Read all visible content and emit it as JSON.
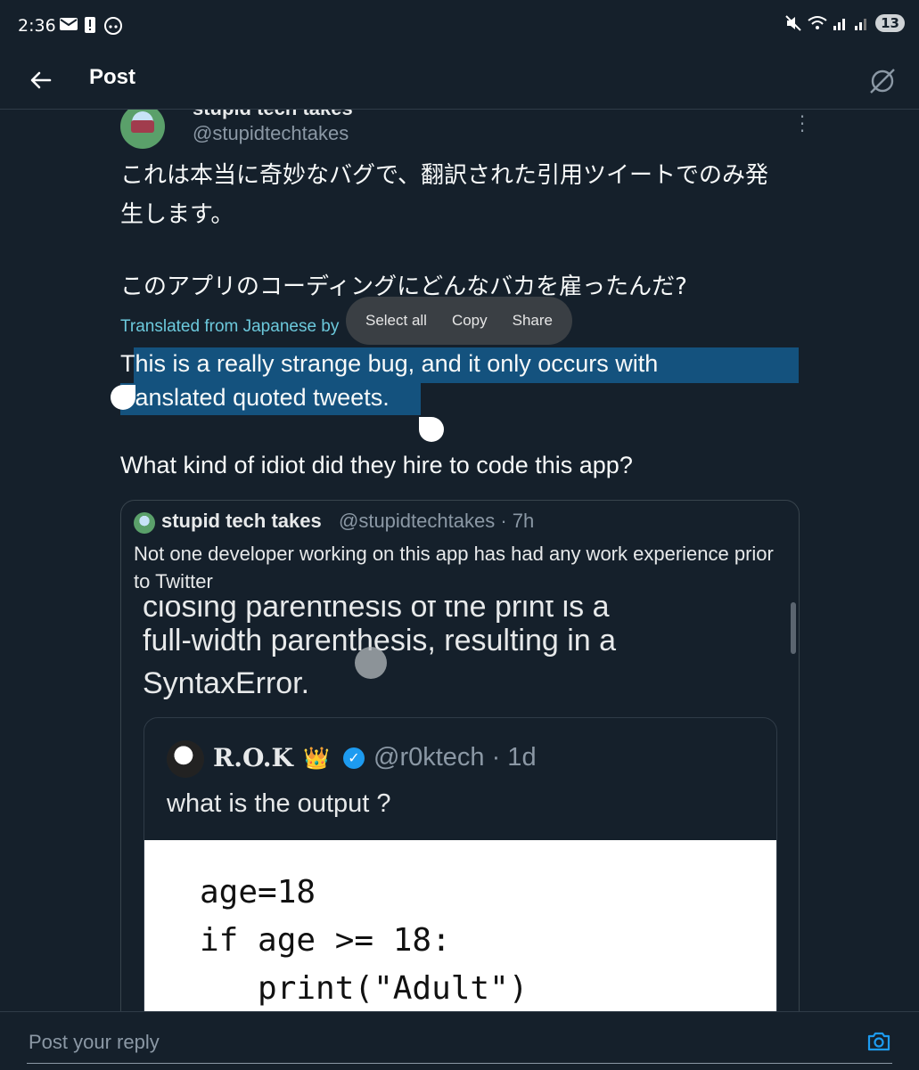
{
  "status": {
    "time": "2:36",
    "icons": [
      "mail-icon",
      "alert-icon",
      "reddit-icon",
      "mute-icon",
      "wifi-icon",
      "signal-icon",
      "signal-icon"
    ],
    "notification_count": "13"
  },
  "header": {
    "title": "Post",
    "back_icon": "arrow-left-icon",
    "grok_icon": "grok-icon"
  },
  "post": {
    "name": "stupid tech takes",
    "handle": "@stupidtechtakes",
    "text_jp_line1": "これは本当に奇妙なバグで、翻訳された引用ツイートでのみ発",
    "text_jp_line2": "生します。",
    "text_jp_line3": "このアプリのコーディングにどんなバカを雇ったんだ?",
    "translated_label": "Translated from Japanese by",
    "text_en_line1a": "T",
    "text_en_line1b": "his is a really strange bug, and it only occurs with",
    "text_en_line2a": "translated quoted tweets",
    "text_en_line2b": ".",
    "text_en_line3": "What kind of idiot did they hire to code this app?"
  },
  "selection_menu": {
    "select_all": "Select all",
    "copy": "Copy",
    "share": "Share"
  },
  "quote": {
    "name": "stupid tech takes",
    "handle_time": "@stupidtechtakes · 7h",
    "text": "Not one developer working on this app has had any work experience prior to Twitter",
    "image": {
      "cut_line": "closing parenthesis of the print is a",
      "line1": "full-width parenthesis, resulting in a",
      "line2": "SyntaxError.",
      "inner": {
        "name": "R.O.K",
        "badge": "👑",
        "handle_time": "@r0ktech · 1d",
        "text": "what is the output ?",
        "code": "age=18\nif age >= 18:\n   print(\"Adult\")"
      }
    }
  },
  "reply": {
    "placeholder": "Post your reply"
  },
  "colors": {
    "background": "#15202b",
    "selection": "#14527e",
    "translated_link": "#6cc9dc",
    "secondary_text": "#8b98a5"
  }
}
